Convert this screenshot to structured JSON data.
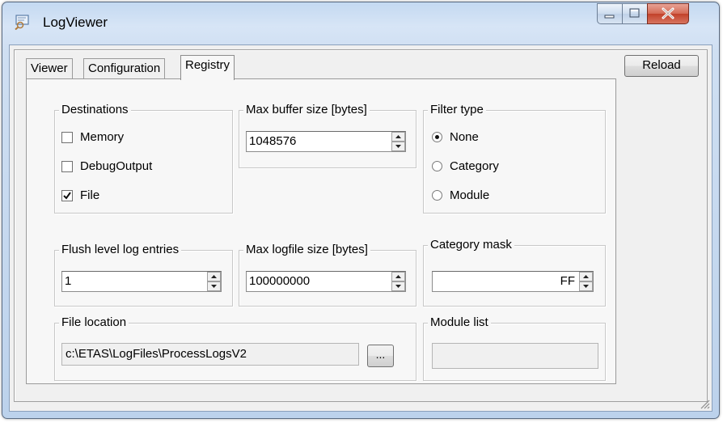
{
  "window": {
    "title": "LogViewer"
  },
  "tabs": [
    {
      "label": "Viewer",
      "active": false
    },
    {
      "label": "Configuration",
      "active": false
    },
    {
      "label": "Registry",
      "active": true
    }
  ],
  "toolbar": {
    "reload_label": "Reload"
  },
  "destinations": {
    "title": "Destinations",
    "options": [
      {
        "label": "Memory",
        "checked": false
      },
      {
        "label": "DebugOutput",
        "checked": false
      },
      {
        "label": "File",
        "checked": true
      }
    ]
  },
  "max_buffer": {
    "title": "Max buffer size [bytes]",
    "value": "1048576"
  },
  "filter_type": {
    "title": "Filter type",
    "options": [
      {
        "label": "None",
        "selected": true
      },
      {
        "label": "Category",
        "selected": false
      },
      {
        "label": "Module",
        "selected": false
      }
    ]
  },
  "flush_level": {
    "title": "Flush level log entries",
    "value": "1"
  },
  "max_logfile": {
    "title": "Max logfile size [bytes]",
    "value": "100000000"
  },
  "category_mask": {
    "title": "Category mask",
    "value": "FF"
  },
  "file_location": {
    "title": "File location",
    "value": "c:\\ETAS\\LogFiles\\ProcessLogsV2",
    "browse_label": "..."
  },
  "module_list": {
    "title": "Module list",
    "value": ""
  }
}
